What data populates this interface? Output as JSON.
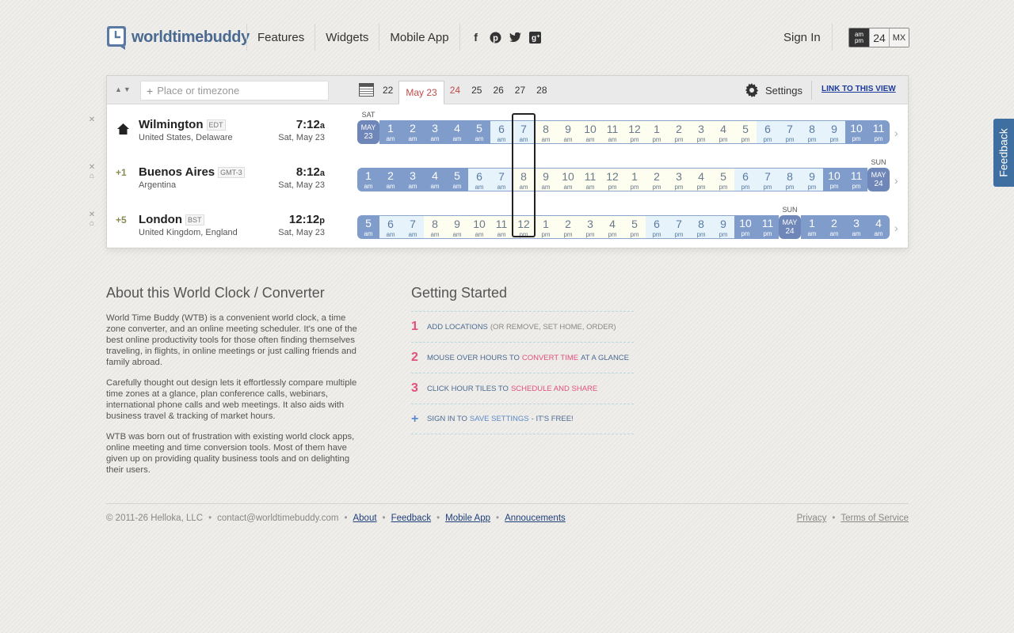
{
  "header": {
    "logo_text": "worldtimebuddy",
    "nav": [
      "Features",
      "Widgets",
      "Mobile App"
    ],
    "social": [
      "facebook-icon",
      "pinterest-icon",
      "twitter-icon",
      "googleplus-icon"
    ],
    "sign_in": "Sign In",
    "format": {
      "ampm": "am pm",
      "h24": "24",
      "mx": "MX",
      "selected": "ampm"
    }
  },
  "toolbar": {
    "search_placeholder": "Place or timezone",
    "dates": [
      "22",
      "May 23",
      "24",
      "25",
      "26",
      "27",
      "28"
    ],
    "selected_date": "May 23",
    "settings_label": "Settings",
    "link_label": "LINK TO THIS VIEW"
  },
  "rows": [
    {
      "city": "Wilmington",
      "tz": "EDT",
      "country": "United States, Delaware",
      "time": "7:12",
      "suffix": "a",
      "date": "Sat, May 23",
      "offset": "",
      "home": true,
      "day_label": "SAT",
      "cells": [
        {
          "h": "MAY",
          "ap": "23",
          "t": "date"
        },
        {
          "h": "1",
          "ap": "am",
          "t": "night"
        },
        {
          "h": "2",
          "ap": "am",
          "t": "night"
        },
        {
          "h": "3",
          "ap": "am",
          "t": "night"
        },
        {
          "h": "4",
          "ap": "am",
          "t": "night"
        },
        {
          "h": "5",
          "ap": "am",
          "t": "night"
        },
        {
          "h": "6",
          "ap": "am",
          "t": "morning"
        },
        {
          "h": "7",
          "ap": "am",
          "t": "morning"
        },
        {
          "h": "8",
          "ap": "am",
          "t": "day"
        },
        {
          "h": "9",
          "ap": "am",
          "t": "day"
        },
        {
          "h": "10",
          "ap": "am",
          "t": "day"
        },
        {
          "h": "11",
          "ap": "am",
          "t": "day"
        },
        {
          "h": "12",
          "ap": "pm",
          "t": "day"
        },
        {
          "h": "1",
          "ap": "pm",
          "t": "day"
        },
        {
          "h": "2",
          "ap": "pm",
          "t": "day"
        },
        {
          "h": "3",
          "ap": "pm",
          "t": "day"
        },
        {
          "h": "4",
          "ap": "pm",
          "t": "day"
        },
        {
          "h": "5",
          "ap": "pm",
          "t": "day"
        },
        {
          "h": "6",
          "ap": "pm",
          "t": "morning"
        },
        {
          "h": "7",
          "ap": "pm",
          "t": "morning"
        },
        {
          "h": "8",
          "ap": "pm",
          "t": "morning"
        },
        {
          "h": "9",
          "ap": "pm",
          "t": "morning"
        },
        {
          "h": "10",
          "ap": "pm",
          "t": "night"
        },
        {
          "h": "11",
          "ap": "pm",
          "t": "night"
        }
      ]
    },
    {
      "city": "Buenos Aires",
      "tz": "GMT-3",
      "country": "Argentina",
      "time": "8:12",
      "suffix": "a",
      "date": "Sat, May 23",
      "offset": "+1",
      "home": false,
      "day_label": "SUN",
      "cells": [
        {
          "h": "1",
          "ap": "am",
          "t": "night"
        },
        {
          "h": "2",
          "ap": "am",
          "t": "night"
        },
        {
          "h": "3",
          "ap": "am",
          "t": "night"
        },
        {
          "h": "4",
          "ap": "am",
          "t": "night"
        },
        {
          "h": "5",
          "ap": "am",
          "t": "night"
        },
        {
          "h": "6",
          "ap": "am",
          "t": "morning"
        },
        {
          "h": "7",
          "ap": "am",
          "t": "morning"
        },
        {
          "h": "8",
          "ap": "am",
          "t": "day"
        },
        {
          "h": "9",
          "ap": "am",
          "t": "day"
        },
        {
          "h": "10",
          "ap": "am",
          "t": "day"
        },
        {
          "h": "11",
          "ap": "am",
          "t": "day"
        },
        {
          "h": "12",
          "ap": "pm",
          "t": "day"
        },
        {
          "h": "1",
          "ap": "pm",
          "t": "day"
        },
        {
          "h": "2",
          "ap": "pm",
          "t": "day"
        },
        {
          "h": "3",
          "ap": "pm",
          "t": "day"
        },
        {
          "h": "4",
          "ap": "pm",
          "t": "day"
        },
        {
          "h": "5",
          "ap": "pm",
          "t": "day"
        },
        {
          "h": "6",
          "ap": "pm",
          "t": "morning"
        },
        {
          "h": "7",
          "ap": "pm",
          "t": "morning"
        },
        {
          "h": "8",
          "ap": "pm",
          "t": "morning"
        },
        {
          "h": "9",
          "ap": "pm",
          "t": "morning"
        },
        {
          "h": "10",
          "ap": "pm",
          "t": "night"
        },
        {
          "h": "11",
          "ap": "pm",
          "t": "night"
        },
        {
          "h": "MAY",
          "ap": "24",
          "t": "date"
        }
      ]
    },
    {
      "city": "London",
      "tz": "BST",
      "country": "United Kingdom, England",
      "time": "12:12",
      "suffix": "p",
      "date": "Sat, May 23",
      "offset": "+5",
      "home": false,
      "day_label": "SUN",
      "cells": [
        {
          "h": "5",
          "ap": "am",
          "t": "night"
        },
        {
          "h": "6",
          "ap": "am",
          "t": "morning"
        },
        {
          "h": "7",
          "ap": "am",
          "t": "morning"
        },
        {
          "h": "8",
          "ap": "am",
          "t": "day"
        },
        {
          "h": "9",
          "ap": "am",
          "t": "day"
        },
        {
          "h": "10",
          "ap": "am",
          "t": "day"
        },
        {
          "h": "11",
          "ap": "am",
          "t": "day"
        },
        {
          "h": "12",
          "ap": "pm",
          "t": "day"
        },
        {
          "h": "1",
          "ap": "pm",
          "t": "day"
        },
        {
          "h": "2",
          "ap": "pm",
          "t": "day"
        },
        {
          "h": "3",
          "ap": "pm",
          "t": "day"
        },
        {
          "h": "4",
          "ap": "pm",
          "t": "day"
        },
        {
          "h": "5",
          "ap": "pm",
          "t": "day"
        },
        {
          "h": "6",
          "ap": "pm",
          "t": "morning"
        },
        {
          "h": "7",
          "ap": "pm",
          "t": "morning"
        },
        {
          "h": "8",
          "ap": "pm",
          "t": "morning"
        },
        {
          "h": "9",
          "ap": "pm",
          "t": "morning"
        },
        {
          "h": "10",
          "ap": "pm",
          "t": "night"
        },
        {
          "h": "11",
          "ap": "pm",
          "t": "night"
        },
        {
          "h": "MAY",
          "ap": "24",
          "t": "date"
        },
        {
          "h": "1",
          "ap": "am",
          "t": "night"
        },
        {
          "h": "2",
          "ap": "am",
          "t": "night"
        },
        {
          "h": "3",
          "ap": "am",
          "t": "night"
        },
        {
          "h": "4",
          "ap": "am",
          "t": "night"
        }
      ]
    }
  ],
  "colors": {
    "night": "#7f9ccb",
    "morning": "#e6f3fb",
    "day": "#fdfdf0",
    "date": "#6f86b8",
    "accent": "#e05080"
  },
  "feedback_label": "Feedback",
  "about": {
    "title": "About this World Clock / Converter",
    "paragraphs": [
      "World Time Buddy (WTB) is a convenient world clock, a time zone converter, and an online meeting scheduler. It's one of the best online productivity tools for those often finding themselves traveling, in flights, in online meetings or just calling friends and family abroad.",
      "Carefully thought out design lets it effortlessly compare multiple time zones at a glance, plan conference calls, webinars, international phone calls and web meetings. It also aids with business travel & tracking of market hours.",
      "WTB was born out of frustration with existing world clock apps, online meeting and time conversion tools. Most of them have given up on providing quality business tools and on delighting their users."
    ]
  },
  "getting_started": {
    "title": "Getting Started",
    "steps": [
      {
        "num": "1",
        "a": "ADD LOCATIONS",
        "b": "(OR REMOVE, SET HOME, ORDER)"
      },
      {
        "num": "2",
        "a": "MOUSE OVER HOURS TO",
        "b": "CONVERT TIME",
        "c": "AT A GLANCE"
      },
      {
        "num": "3",
        "a": "CLICK HOUR TILES TO",
        "b": "SCHEDULE AND SHARE"
      },
      {
        "num": "+",
        "a": "SIGN IN TO",
        "b": "SAVE SETTINGS",
        "c": "- IT'S FREE!"
      }
    ]
  },
  "footer": {
    "copyright": "© 2011-26 Helloka, LLC",
    "contact": "contact@worldtimebuddy.com",
    "links": [
      "About",
      "Feedback",
      "Mobile App",
      "Annoucements"
    ],
    "right_links": [
      "Privacy",
      "Terms of Service"
    ]
  }
}
